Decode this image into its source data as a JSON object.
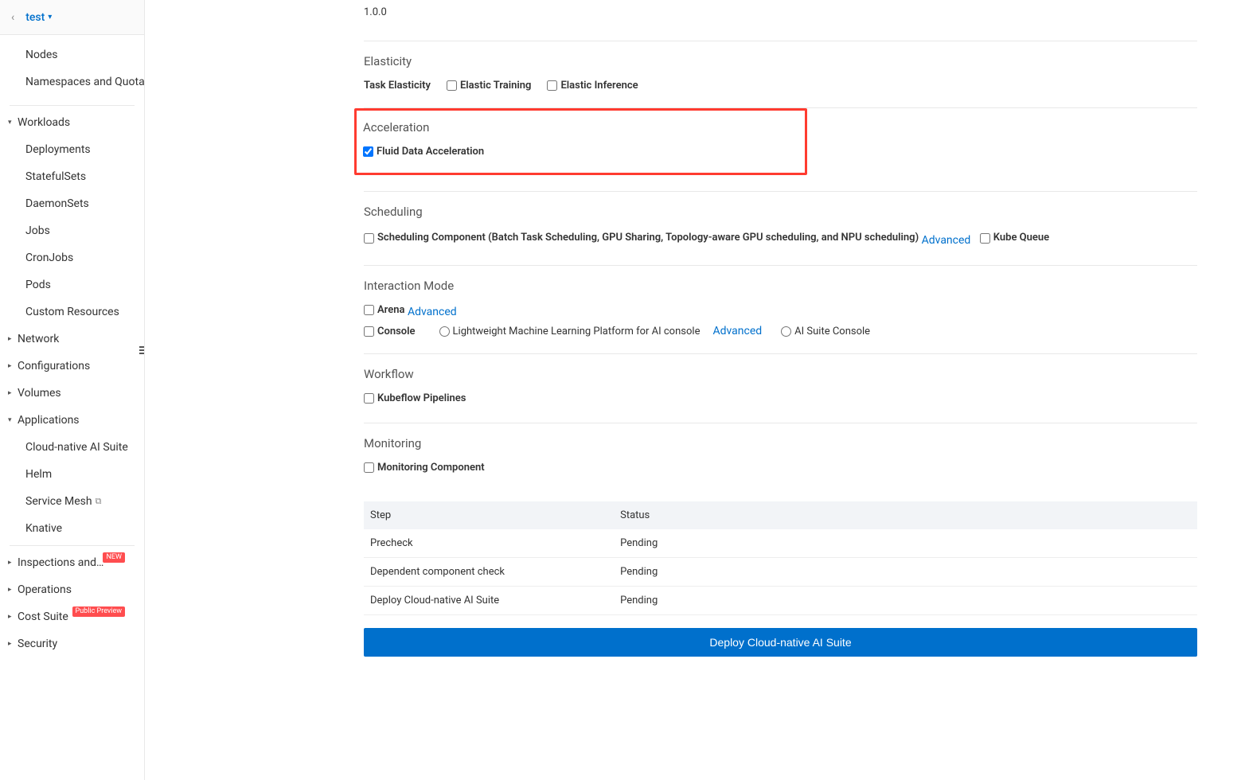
{
  "header": {
    "cluster": "test"
  },
  "sidebar": {
    "section1": [
      "Nodes",
      "Namespaces and Quotas"
    ],
    "workloads": {
      "label": "Workloads",
      "items": [
        "Deployments",
        "StatefulSets",
        "DaemonSets",
        "Jobs",
        "CronJobs",
        "Pods",
        "Custom Resources"
      ]
    },
    "network": "Network",
    "configurations": "Configurations",
    "volumes": "Volumes",
    "applications": {
      "label": "Applications",
      "items": [
        "Cloud-native AI Suite",
        "Helm",
        "Service Mesh",
        "Knative"
      ]
    },
    "inspections": "Inspections and Diagnosis",
    "inspections_badge": "NEW",
    "operations": "Operations",
    "cost_suite": "Cost Suite",
    "cost_suite_badge": "Public Preview",
    "security": "Security"
  },
  "main": {
    "version": "1.0.0",
    "elasticity": {
      "title": "Elasticity",
      "task_label": "Task Elasticity",
      "training": "Elastic Training",
      "inference": "Elastic Inference"
    },
    "acceleration": {
      "title": "Acceleration",
      "fluid": "Fluid Data Acceleration"
    },
    "scheduling": {
      "title": "Scheduling",
      "component": "Scheduling Component (Batch Task Scheduling, GPU Sharing, Topology-aware GPU scheduling, and NPU scheduling)",
      "advanced": "Advanced",
      "kube_queue": "Kube Queue"
    },
    "interaction": {
      "title": "Interaction Mode",
      "arena": "Arena",
      "advanced": "Advanced",
      "console": "Console",
      "lightweight": "Lightweight Machine Learning Platform for AI console",
      "ai_suite": "AI Suite Console"
    },
    "workflow": {
      "title": "Workflow",
      "kubeflow": "Kubeflow Pipelines"
    },
    "monitoring": {
      "title": "Monitoring",
      "component": "Monitoring Component"
    },
    "table": {
      "headers": [
        "Step",
        "Status"
      ],
      "rows": [
        {
          "step": "Precheck",
          "status": "Pending"
        },
        {
          "step": "Dependent component check",
          "status": "Pending"
        },
        {
          "step": "Deploy Cloud-native AI Suite",
          "status": "Pending"
        }
      ]
    },
    "deploy_button": "Deploy Cloud-native AI Suite"
  }
}
